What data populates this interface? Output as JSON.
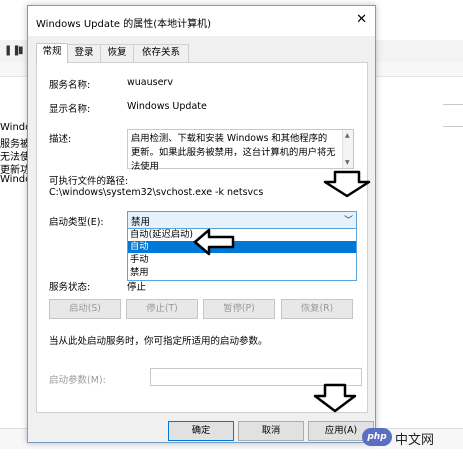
{
  "background": {
    "partial_lines": [
      "Windo",
      "服务被禁",
      "无法使用",
      "更新功能",
      " Windo"
    ]
  },
  "dialog": {
    "title": "Windows Update 的属性(本地计算机)",
    "close_glyph": "✕",
    "tabs": [
      "常规",
      "登录",
      "恢复",
      "依存关系"
    ],
    "fields": {
      "service_name_label": "服务名称:",
      "service_name_value": "wuauserv",
      "display_name_label": "显示名称:",
      "display_name_value": "Windows Update",
      "description_label": "描述:",
      "description_value": "启用检测、下载和安装 Windows 和其他程序的更新。如果此服务被禁用，这台计算机的用户将无法使用",
      "exe_path_label": "可执行文件的路径:",
      "exe_path_value": "C:\\windows\\system32\\svchost.exe -k netsvcs",
      "startup_type_label": "启动类型(E):",
      "startup_type_value": "禁用",
      "startup_options": [
        "自动(延迟启动)",
        "自动",
        "手动",
        "禁用"
      ],
      "highlighted_option": "自动",
      "service_status_label": "服务状态:",
      "service_status_value": "停止",
      "hint_text": "当从此处启动服务时，你可指定所适用的启动参数。",
      "start_params_label": "启动参数(M):"
    },
    "service_buttons": {
      "start": "启动(S)",
      "stop": "停止(T)",
      "pause": "暂停(P)",
      "resume": "恢复(R)"
    },
    "footer_buttons": {
      "ok": "确定",
      "cancel": "取消",
      "apply": "应用(A)"
    }
  },
  "watermark": {
    "logo_text": "php",
    "site_text": "中文网"
  },
  "colors": {
    "accent": "#0078d7",
    "dialog_bg": "#f0f0f0",
    "combo_bg": "#e5f1fb"
  }
}
